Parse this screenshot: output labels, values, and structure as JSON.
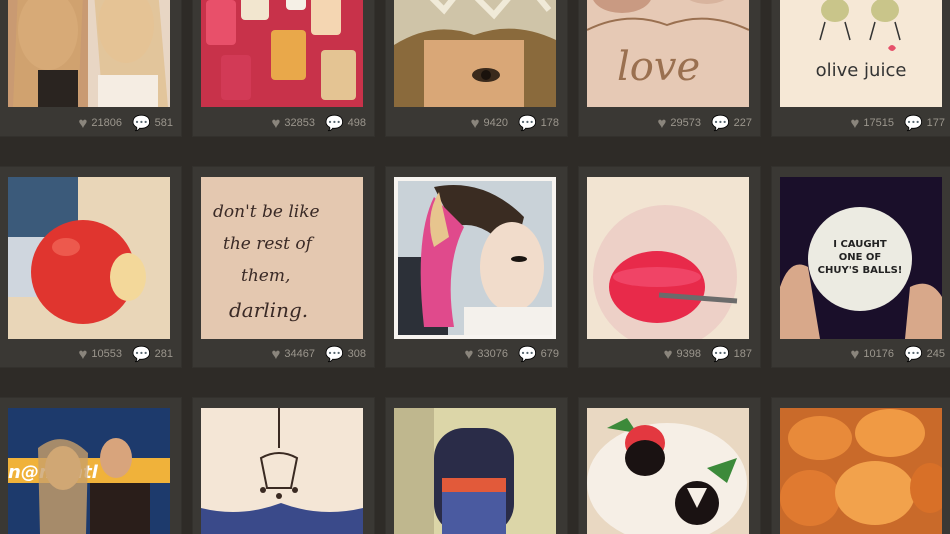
{
  "grid": {
    "rows": [
      [
        {
          "name": "photo-friends-selfie",
          "likes": "21806",
          "comments": "581"
        },
        {
          "name": "photo-nail-polish",
          "likes": "32853",
          "comments": "498"
        },
        {
          "name": "photo-hair-foils",
          "likes": "9420",
          "comments": "178"
        },
        {
          "name": "photo-love-necklace",
          "likes": "29573",
          "comments": "227"
        },
        {
          "name": "photo-olive-juice",
          "likes": "17515",
          "comments": "177"
        }
      ],
      [
        {
          "name": "photo-bitten-apple",
          "likes": "10553",
          "comments": "281"
        },
        {
          "name": "photo-handwritten-note",
          "likes": "34467",
          "comments": "308"
        },
        {
          "name": "photo-pink-hair",
          "likes": "33076",
          "comments": "679"
        },
        {
          "name": "photo-pink-bowl",
          "likes": "9398",
          "comments": "187"
        },
        {
          "name": "photo-ball",
          "likes": "10176",
          "comments": "245"
        }
      ],
      [
        {
          "name": "photo-tv-studio",
          "likes": "",
          "comments": ""
        },
        {
          "name": "photo-chandelier-necklace",
          "likes": "",
          "comments": ""
        },
        {
          "name": "photo-airplane-window",
          "likes": "",
          "comments": ""
        },
        {
          "name": "photo-strawberries",
          "likes": "",
          "comments": ""
        },
        {
          "name": "photo-fried-food",
          "likes": "",
          "comments": ""
        }
      ]
    ],
    "texts": {
      "olive_juice": "olive juice",
      "love": "love",
      "note_line1": "don't be like",
      "note_line2": "the rest of",
      "note_line3": "them,",
      "note_line4": "darling.",
      "ball_line1": "I CAUGHT",
      "ball_line2": "ONE OF",
      "ball_line3": "CHUY'S BALLS!",
      "studio_sign": "n@n ontl"
    },
    "icons": {
      "like": "heart-icon",
      "comment": "speech-bubble-icon"
    },
    "colors": {
      "background": "#2e2b27",
      "card": "#3a3834",
      "stat_text": "#9b968d"
    }
  }
}
